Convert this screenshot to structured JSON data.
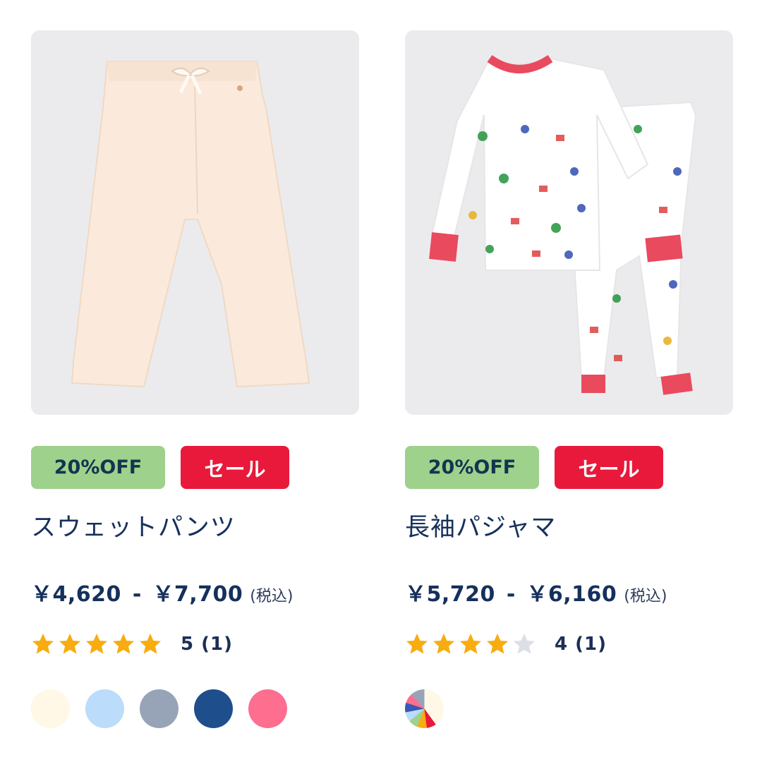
{
  "products": [
    {
      "discount_badge": "20%OFF",
      "sale_badge": "セール",
      "name": "スウェットパンツ",
      "price_min": "￥4,620",
      "price_separator": "-",
      "price_max": "￥7,700",
      "tax_note": "(税込)",
      "rating_value": 5,
      "rating_text": "5 (1)",
      "swatches": [
        "#fff8e6",
        "#bcdcfb",
        "#97a4b8",
        "#1f4e8c",
        "#fd6e8f"
      ],
      "image_icon": "sweatpants-image"
    },
    {
      "discount_badge": "20%OFF",
      "sale_badge": "セール",
      "name": "長袖パジャマ",
      "price_min": "￥5,720",
      "price_separator": "-",
      "price_max": "￥6,160",
      "tax_note": "(税込)",
      "rating_value": 4,
      "rating_text": "4 (1)",
      "swatches": [
        "multicolor"
      ],
      "image_icon": "pajama-set-image"
    }
  ],
  "colors": {
    "star_filled": "#f7ac0f",
    "star_empty": "#dcdfe6",
    "badge_off_bg": "#9ed18c",
    "badge_sale_bg": "#e8193a",
    "text_primary": "#15305c"
  }
}
